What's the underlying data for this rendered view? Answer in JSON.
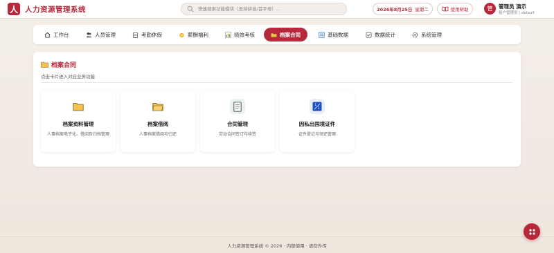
{
  "header": {
    "logo_char": "人",
    "title": "人力资源管理系统",
    "search_placeholder": "快速搜索功能模块（支持拼音/首字母）...",
    "date": "2026年8月25日",
    "weekday": "星期二",
    "help_label": "使用帮助",
    "user_avatar_char": "管",
    "user_name": "管理员 演示",
    "user_sub": "租户管理员 | default"
  },
  "nav": {
    "items": [
      {
        "label": "工作台",
        "icon": "home-icon"
      },
      {
        "label": "人员管理",
        "icon": "people-icon"
      },
      {
        "label": "考勤休假",
        "icon": "clipboard-icon"
      },
      {
        "label": "薪酬福利",
        "icon": "medal-icon"
      },
      {
        "label": "绩效考核",
        "icon": "bar-chart-icon"
      },
      {
        "label": "档案合同",
        "icon": "folder-icon",
        "active": true
      },
      {
        "label": "基础数据",
        "icon": "database-icon"
      },
      {
        "label": "数据统计",
        "icon": "checklist-icon"
      },
      {
        "label": "系统管理",
        "icon": "gear-icon"
      }
    ]
  },
  "section": {
    "title": "档案合同",
    "subtitle": "点击卡片进入对应业务功能"
  },
  "cards": [
    {
      "title": "档案资料管理",
      "desc": "人事档案电子化、借阅及归档管理",
      "icon": "folder-icon"
    },
    {
      "title": "档案借阅",
      "desc": "人事档案借阅与归还",
      "icon": "folder-icon"
    },
    {
      "title": "合同管理",
      "desc": "劳动合同签订与续签",
      "icon": "document-icon"
    },
    {
      "title": "因私出国境证件",
      "desc": "证件登记与领还管理",
      "icon": "passport-icon"
    }
  ],
  "footer": "人力资源管理系统 © 2026 · 内部使用 · 请勿外传",
  "colors": {
    "accent": "#b8283b",
    "background": "#f4efe9"
  }
}
